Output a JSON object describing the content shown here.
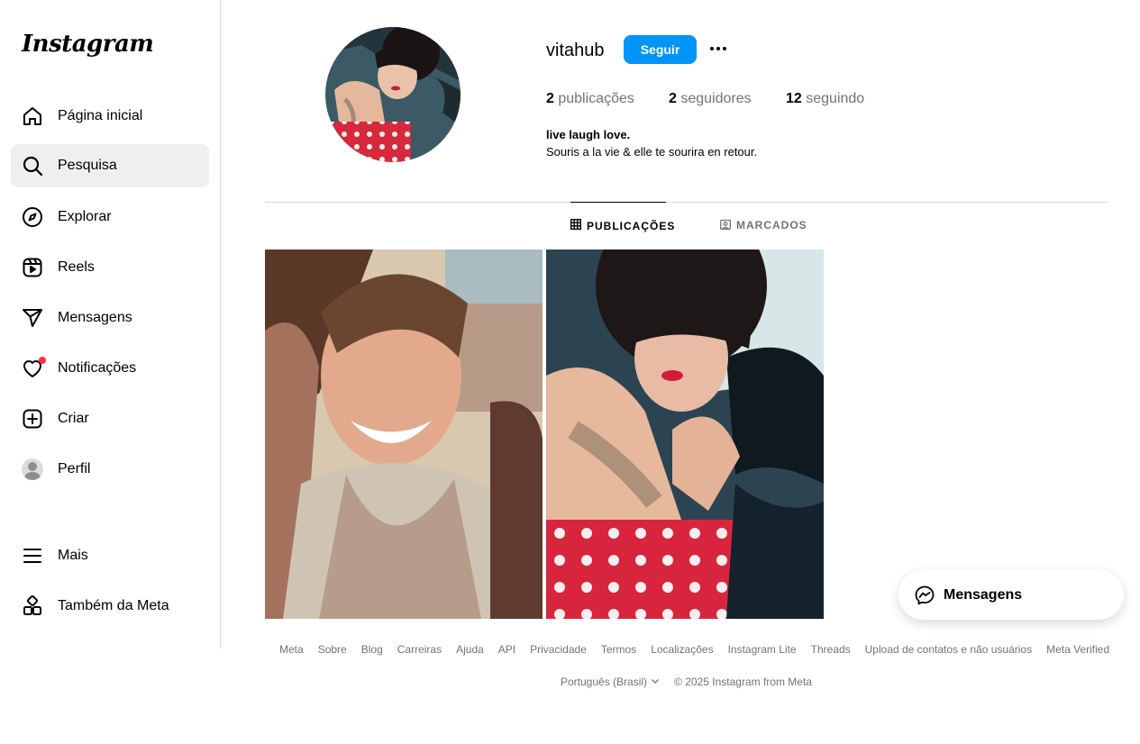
{
  "app": {
    "logo_text": "Instagram"
  },
  "sidebar": {
    "items": [
      {
        "label": "Página inicial",
        "icon": "home-icon"
      },
      {
        "label": "Pesquisa",
        "icon": "search-icon"
      },
      {
        "label": "Explorar",
        "icon": "compass-icon"
      },
      {
        "label": "Reels",
        "icon": "reels-icon"
      },
      {
        "label": "Mensagens",
        "icon": "send-icon"
      },
      {
        "label": "Notificações",
        "icon": "heart-icon"
      },
      {
        "label": "Criar",
        "icon": "plus-square-icon"
      },
      {
        "label": "Perfil",
        "icon": "avatar"
      },
      {
        "label": "Mais",
        "icon": "menu-icon"
      },
      {
        "label": "Também da Meta",
        "icon": "meta-apps-icon"
      }
    ],
    "active": "Pesquisa"
  },
  "profile": {
    "username": "vitahub",
    "follow_label": "Seguir",
    "stats": {
      "posts_count": "2",
      "posts_label": "publicações",
      "followers_count": "2",
      "followers_label": "seguidores",
      "following_count": "12",
      "following_label": "seguindo"
    },
    "bio_name": "live laugh love.",
    "bio_text": "Souris a la vie & elle te sourira en retour."
  },
  "tabs": [
    {
      "label": "PUBLICAÇÕES",
      "icon": "grid-icon",
      "active": true
    },
    {
      "label": "MARCADOS",
      "icon": "tagged-icon",
      "active": false
    }
  ],
  "footer": {
    "links": [
      "Meta",
      "Sobre",
      "Blog",
      "Carreiras",
      "Ajuda",
      "API",
      "Privacidade",
      "Termos",
      "Localizações",
      "Instagram Lite",
      "Threads",
      "Upload de contatos e não usuários",
      "Meta Verified"
    ],
    "language": "Português (Brasil)",
    "copyright": "© 2025 Instagram from Meta"
  },
  "messages_pill": {
    "label": "Mensagens"
  },
  "colors": {
    "accent": "#0095f6",
    "notification": "#ff3040",
    "muted": "#737373",
    "divider": "#dbdbdb"
  }
}
